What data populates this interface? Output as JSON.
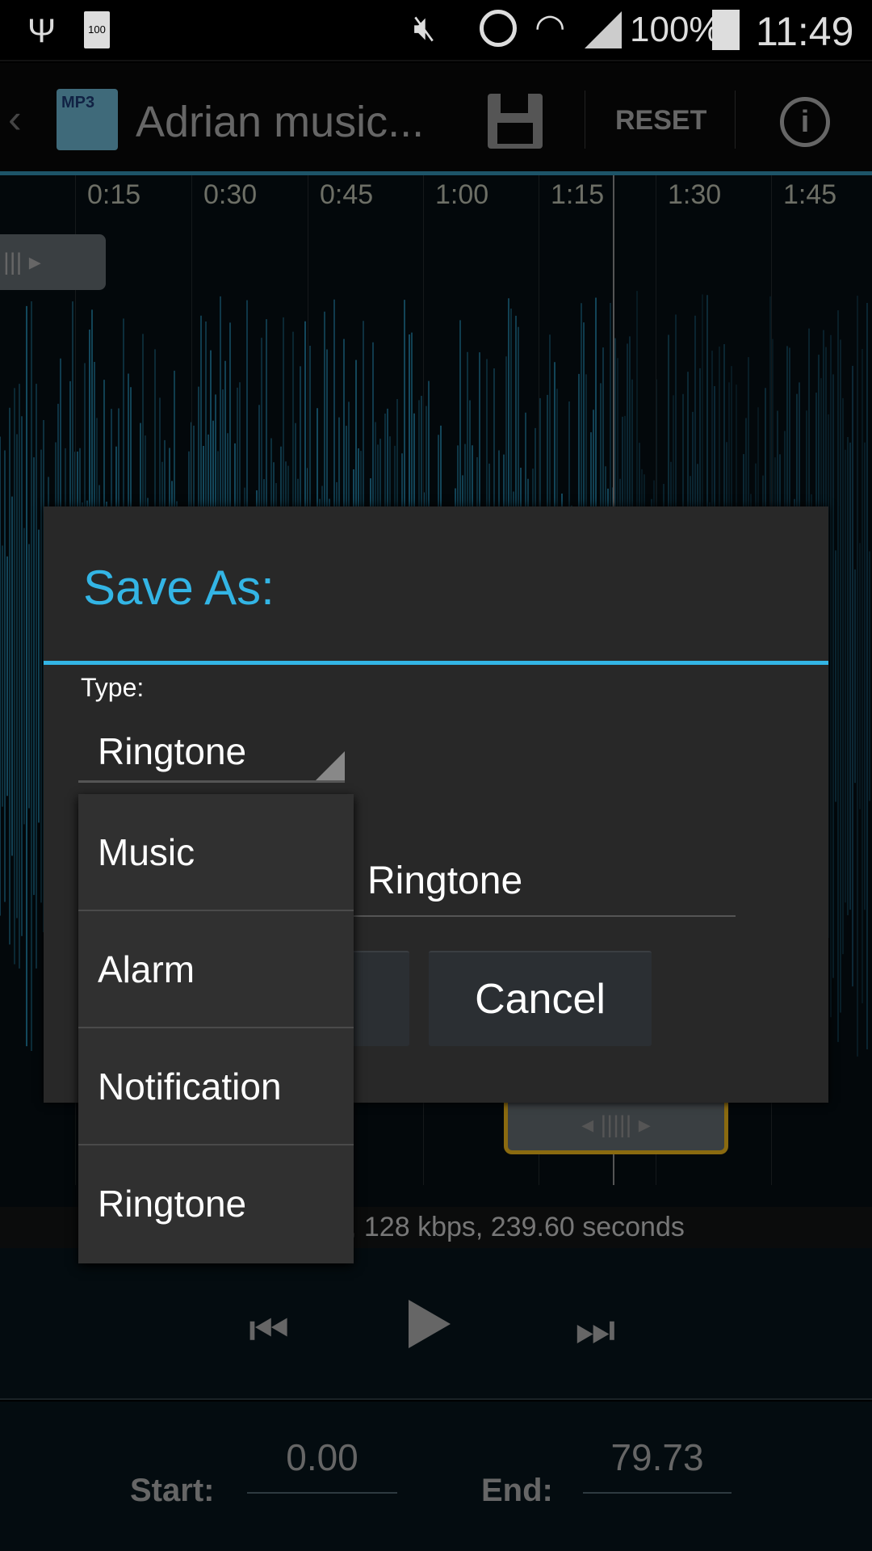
{
  "status_bar": {
    "battery_saver_badge": "100",
    "battery_percent": "100%",
    "time": "11:49",
    "icons": [
      "usb-icon",
      "battery-saver-icon",
      "vibrate-mute-icon",
      "alarm-icon",
      "wifi-icon",
      "signal-icon",
      "battery-icon"
    ]
  },
  "action_bar": {
    "title": "Adrian music...",
    "reset_label": "RESET",
    "app_icon_text": "MP3",
    "icons": [
      "back-chevron-icon",
      "save-icon",
      "info-icon"
    ]
  },
  "timeline": {
    "ticks": [
      "0:15",
      "0:30",
      "0:45",
      "1:00",
      "1:15",
      "1:30",
      "1:45"
    ]
  },
  "info_text": "z, 128 kbps, 239.60 seconds",
  "bottom": {
    "start_label": "Start:",
    "start_value": "0.00",
    "end_label": "End:",
    "end_value": "79.73"
  },
  "dialog": {
    "title": "Save As:",
    "type_label": "Type:",
    "type_selected": "Ringtone",
    "name_value": "Ringtone",
    "cancel_label": "Cancel"
  },
  "dropdown": {
    "options": [
      "Music",
      "Alarm",
      "Notification",
      "Ringtone"
    ]
  },
  "colors": {
    "accent": "#33b5e5",
    "waveform": "#1e6f8e",
    "handle": "#b8860b"
  }
}
